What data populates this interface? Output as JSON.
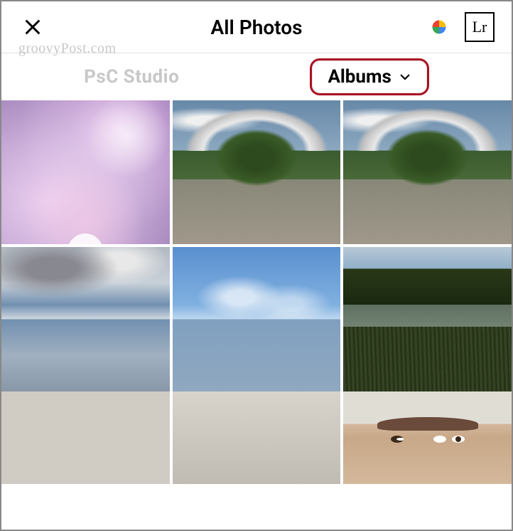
{
  "header": {
    "title": "All Photos",
    "lr_label": "Lr"
  },
  "watermark": "groovyPost.com",
  "tabs": {
    "psc_label": "PsC Studio",
    "albums_label": "Albums"
  }
}
